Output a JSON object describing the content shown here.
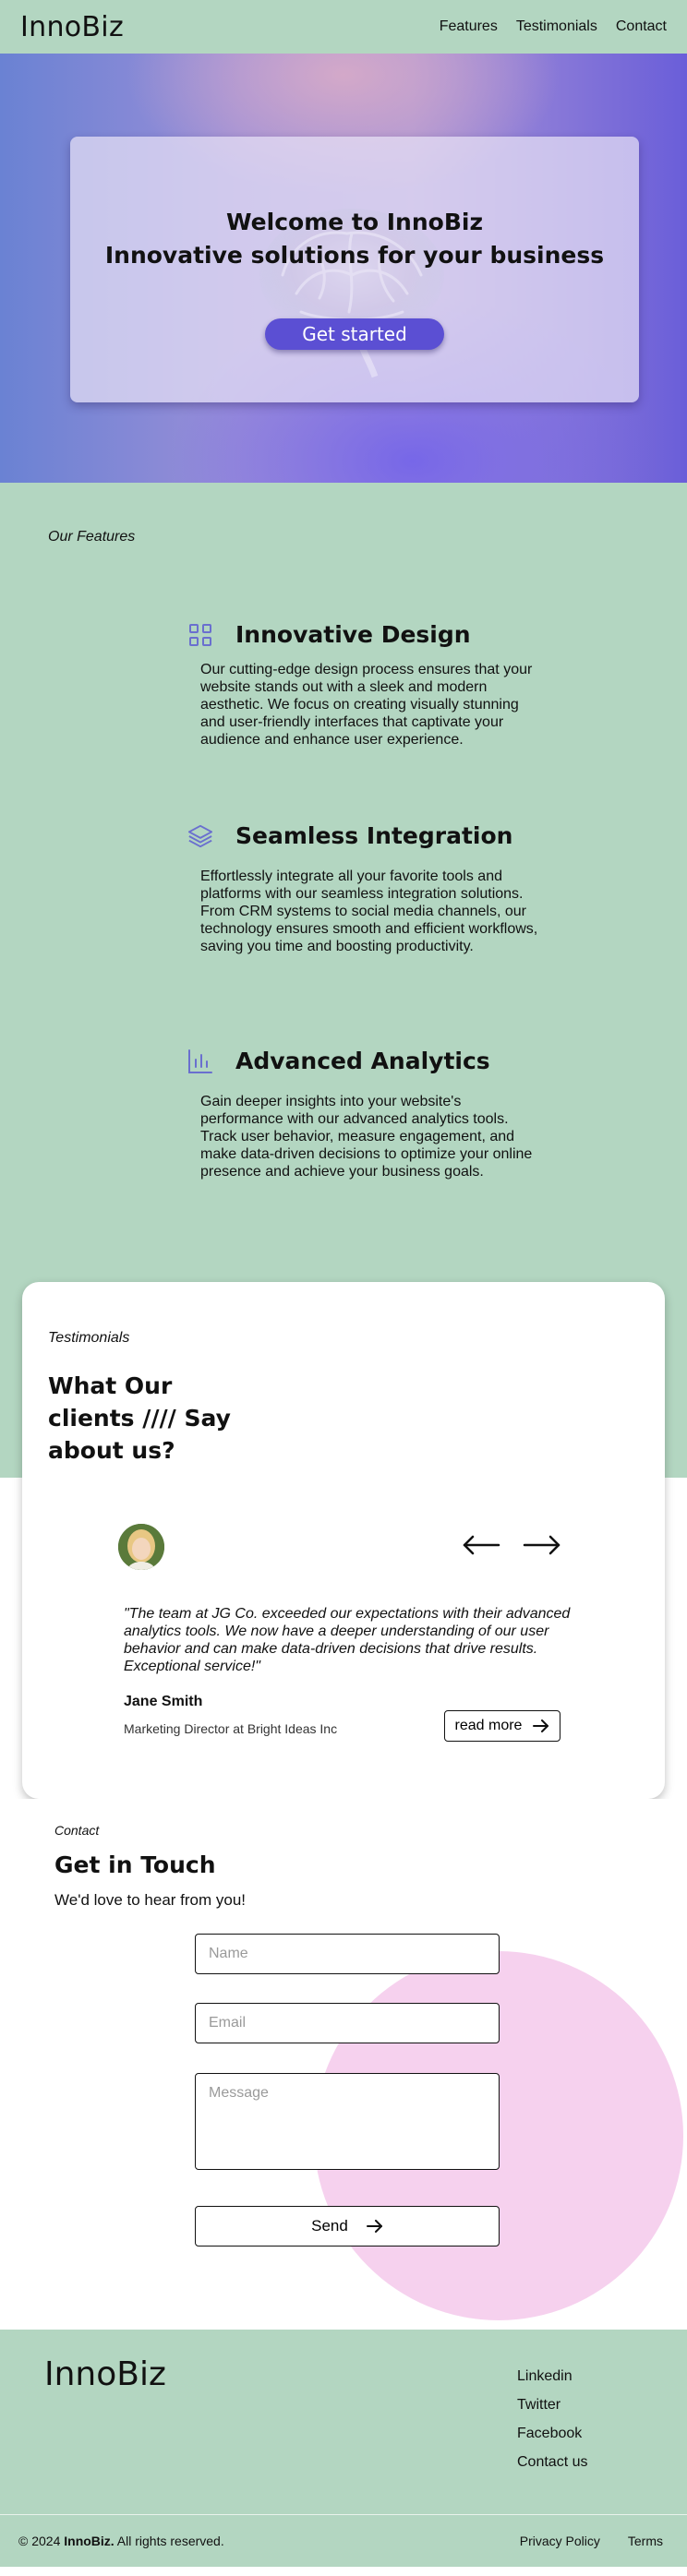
{
  "header": {
    "logo": "InnoBiz",
    "nav": [
      "Features",
      "Testimonials",
      "Contact"
    ]
  },
  "hero": {
    "title": "Welcome to InnoBiz",
    "subtitle": "Innovative solutions for your business",
    "cta": "Get started"
  },
  "features": {
    "eyebrow": "Our Features",
    "items": [
      {
        "icon": "grid-icon",
        "title": "Innovative Design",
        "description": "Our cutting-edge design process ensures that your website stands out with a sleek and modern aesthetic. We focus on creating visually stunning and user-friendly interfaces that captivate your audience and enhance user experience."
      },
      {
        "icon": "layers-icon",
        "title": "Seamless Integration",
        "description": "Effortlessly integrate all your favorite tools and platforms with our seamless integration solutions. From CRM systems to social media channels, our technology ensures smooth and efficient workflows, saving you time and boosting productivity."
      },
      {
        "icon": "bar-chart-icon",
        "title": "Advanced Analytics",
        "description": "Gain deeper insights into your website's performance with our advanced analytics tools. Track user behavior, measure engagement, and make data-driven decisions to optimize your online presence and achieve your business goals."
      }
    ]
  },
  "testimonials": {
    "eyebrow": "Testimonials",
    "heading": "What Our clients  ////  Say about us?",
    "quote": "\"The team at JG Co. exceeded our expectations with their advanced analytics tools. We now have a deeper understanding of our user behavior and can make data-driven decisions that drive results. Exceptional service!\"",
    "name": "Jane Smith",
    "role": "Marketing Director at Bright Ideas Inc",
    "read_more": "read more"
  },
  "contact": {
    "eyebrow": "Contact",
    "title": "Get in Touch",
    "subtitle": "We'd love to hear from you!",
    "name_placeholder": "Name",
    "email_placeholder": "Email",
    "message_placeholder": "Message",
    "send": "Send"
  },
  "footer": {
    "logo": "InnoBiz",
    "links": [
      "Linkedin",
      "Twitter",
      "Facebook",
      "Contact us"
    ],
    "copyright_prefix": "© 2024 ",
    "copyright_brand": "InnoBiz.",
    "copyright_suffix": " All rights reserved.",
    "legal": [
      "Privacy Policy",
      "Terms"
    ]
  },
  "colors": {
    "mint": "#b3d6c1",
    "accent": "#5b4fd3",
    "pink": "#f6d1ee",
    "icon": "#6a6fcf"
  }
}
